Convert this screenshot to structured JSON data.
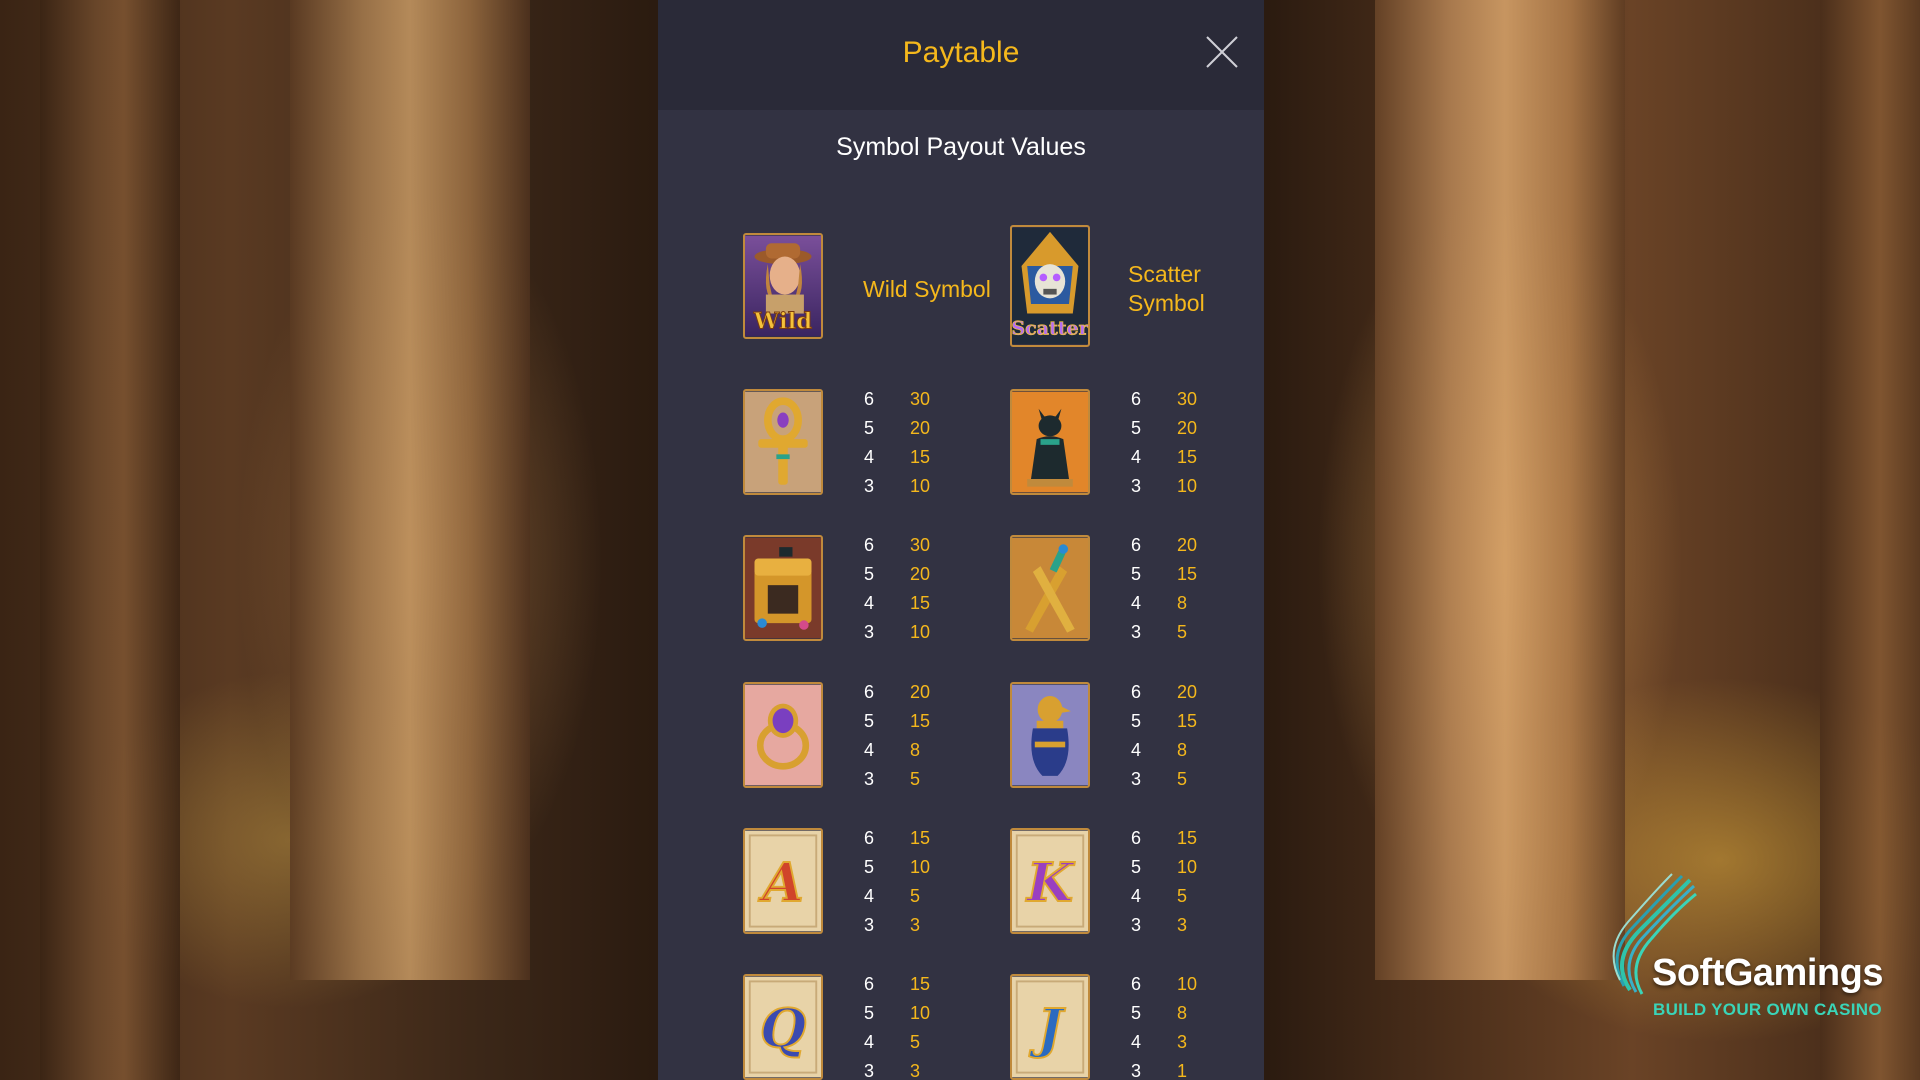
{
  "header": {
    "title": "Paytable"
  },
  "section": {
    "title": "Symbol Payout Values"
  },
  "special": [
    {
      "label_line1": "Wild Symbol",
      "label_line2": "",
      "icon": "wild-explorer-icon",
      "tile_text": "Wild"
    },
    {
      "label_line1": "Scatter",
      "label_line2": "Symbol",
      "icon": "scatter-pharaoh-skull-icon",
      "tile_text": "Scatter"
    }
  ],
  "symbols": [
    {
      "icon": "ankh-icon",
      "tile_text": "",
      "pays": [
        {
          "count": "6",
          "value": "30"
        },
        {
          "count": "5",
          "value": "20"
        },
        {
          "count": "4",
          "value": "15"
        },
        {
          "count": "3",
          "value": "10"
        }
      ]
    },
    {
      "icon": "bastet-cat-icon",
      "tile_text": "",
      "pays": [
        {
          "count": "6",
          "value": "30"
        },
        {
          "count": "5",
          "value": "20"
        },
        {
          "count": "4",
          "value": "15"
        },
        {
          "count": "3",
          "value": "10"
        }
      ]
    },
    {
      "icon": "treasure-chest-icon",
      "tile_text": "",
      "pays": [
        {
          "count": "6",
          "value": "30"
        },
        {
          "count": "5",
          "value": "20"
        },
        {
          "count": "4",
          "value": "15"
        },
        {
          "count": "3",
          "value": "10"
        }
      ]
    },
    {
      "icon": "daggers-icon",
      "tile_text": "",
      "pays": [
        {
          "count": "6",
          "value": "20"
        },
        {
          "count": "5",
          "value": "15"
        },
        {
          "count": "4",
          "value": "8"
        },
        {
          "count": "3",
          "value": "5"
        }
      ]
    },
    {
      "icon": "scarab-ring-icon",
      "tile_text": "",
      "pays": [
        {
          "count": "6",
          "value": "20"
        },
        {
          "count": "5",
          "value": "15"
        },
        {
          "count": "4",
          "value": "8"
        },
        {
          "count": "3",
          "value": "5"
        }
      ]
    },
    {
      "icon": "canopic-jar-icon",
      "tile_text": "",
      "pays": [
        {
          "count": "6",
          "value": "20"
        },
        {
          "count": "5",
          "value": "15"
        },
        {
          "count": "4",
          "value": "8"
        },
        {
          "count": "3",
          "value": "5"
        }
      ]
    },
    {
      "icon": "letter-a-icon",
      "tile_text": "A",
      "pays": [
        {
          "count": "6",
          "value": "15"
        },
        {
          "count": "5",
          "value": "10"
        },
        {
          "count": "4",
          "value": "5"
        },
        {
          "count": "3",
          "value": "3"
        }
      ]
    },
    {
      "icon": "letter-k-icon",
      "tile_text": "K",
      "pays": [
        {
          "count": "6",
          "value": "15"
        },
        {
          "count": "5",
          "value": "10"
        },
        {
          "count": "4",
          "value": "5"
        },
        {
          "count": "3",
          "value": "3"
        }
      ]
    },
    {
      "icon": "letter-q-icon",
      "tile_text": "Q",
      "pays": [
        {
          "count": "6",
          "value": "15"
        },
        {
          "count": "5",
          "value": "10"
        },
        {
          "count": "4",
          "value": "5"
        },
        {
          "count": "3",
          "value": "3"
        }
      ]
    },
    {
      "icon": "letter-j-icon",
      "tile_text": "J",
      "pays": [
        {
          "count": "6",
          "value": "10"
        },
        {
          "count": "5",
          "value": "8"
        },
        {
          "count": "4",
          "value": "3"
        },
        {
          "count": "3",
          "value": "1"
        }
      ]
    }
  ],
  "watermark": {
    "name": "SoftGamings",
    "tagline": "BUILD YOUR OWN CASINO"
  },
  "colors": {
    "accent": "#f5b81c",
    "panel": "#323242",
    "header": "#2a2a38",
    "text": "#ffffff",
    "brand_teal": "#3ad4b8"
  }
}
